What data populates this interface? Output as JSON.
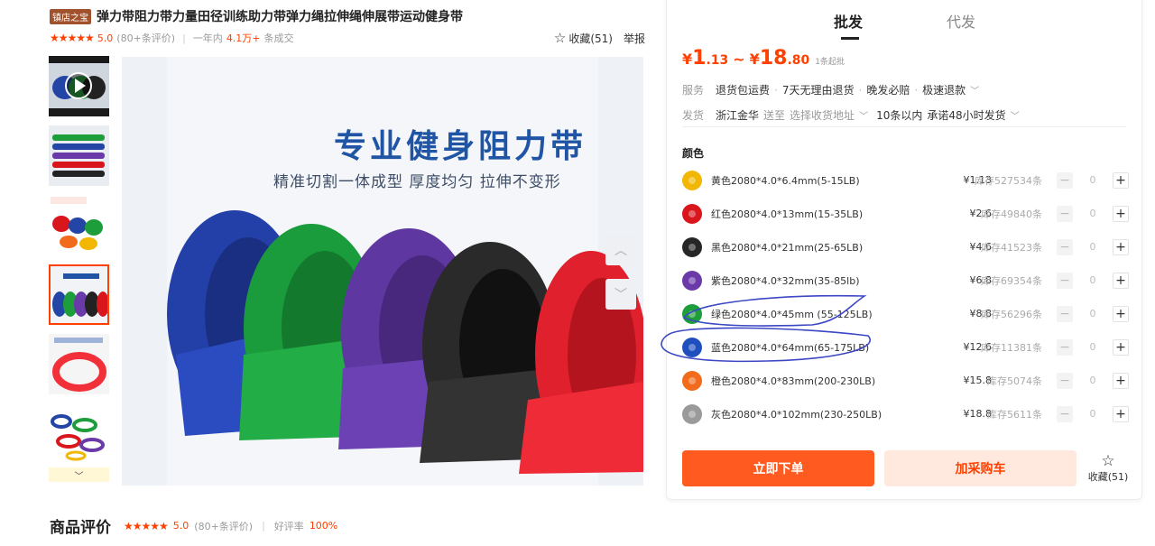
{
  "product": {
    "shop_badge": "镇店之宝",
    "title": "弹力带阻力带力量田径训练助力带弹力绳拉伸绳伸展带运动健身带",
    "stars": "★★★★★",
    "score": "5.0",
    "review_count": "(80+条评价)",
    "period": "一年内",
    "sold_num": "4.1万+",
    "sold_suffix": "条成交",
    "favorite": "收藏(51)",
    "report": "举报"
  },
  "image": {
    "headline": "专业健身阻力带",
    "subline": "精准切割一体成型 厚度均匀 拉伸不变形",
    "thumb_more": "﹀"
  },
  "reviews": {
    "title": "商品评价",
    "stars": "★★★★★",
    "score": "5.0",
    "count": "(80+条评价)",
    "good_rate_label": "好评率",
    "good_rate": "100%"
  },
  "panel": {
    "tabs": [
      "批发",
      "代发"
    ],
    "price": {
      "currency": "¥",
      "low_int": "1",
      "low_dec": ".13",
      "tilde": "~",
      "high_int": "18",
      "high_dec": ".80",
      "min_order": "1条起批"
    },
    "service": {
      "label": "服务",
      "items": [
        "退货包运费",
        "7天无理由退货",
        "晚发必赔",
        "极速退款"
      ]
    },
    "shipping": {
      "label": "发货",
      "origin": "浙江金华",
      "to": "送至",
      "address": "选择收货地址",
      "limit": "10条以内",
      "promise": "承诺48小时发货"
    },
    "color_label": "颜色",
    "skus": [
      {
        "name": "黄色2080*4.0*6.4mm(5-15LB)",
        "price": "¥1.13",
        "stock": "库存527534条",
        "qty": "0",
        "color": "#f2b705"
      },
      {
        "name": "红色2080*4.0*13mm(15-35LB)",
        "price": "¥2.6",
        "stock": "库存49840条",
        "qty": "0",
        "color": "#d9161c"
      },
      {
        "name": "黑色2080*4.0*21mm(25-65LB)",
        "price": "¥4.6",
        "stock": "库存41523条",
        "qty": "0",
        "color": "#262626"
      },
      {
        "name": "紫色2080*4.0*32mm(35-85lb)",
        "price": "¥6.8",
        "stock": "库存69354条",
        "qty": "0",
        "color": "#6a3aa8"
      },
      {
        "name": "绿色2080*4.0*45mm  (55-125LB)",
        "price": "¥8.8",
        "stock": "库存56296条",
        "qty": "0",
        "color": "#1e9d3b"
      },
      {
        "name": "蓝色2080*4.0*64mm(65-175LB)",
        "price": "¥12.6",
        "stock": "库存11381条",
        "qty": "0",
        "color": "#1f4fbf"
      },
      {
        "name": "橙色2080*4.0*83mm(200-230LB)",
        "price": "¥15.8",
        "stock": "库存5074条",
        "qty": "0",
        "color": "#f26a1b"
      },
      {
        "name": "灰色2080*4.0*102mm(230-250LB)",
        "price": "¥18.8",
        "stock": "库存5611条",
        "qty": "0",
        "color": "#9a9a9a"
      }
    ],
    "order_button": "立即下单",
    "cart_button": "加采购车",
    "favorite": "收藏(51)"
  }
}
